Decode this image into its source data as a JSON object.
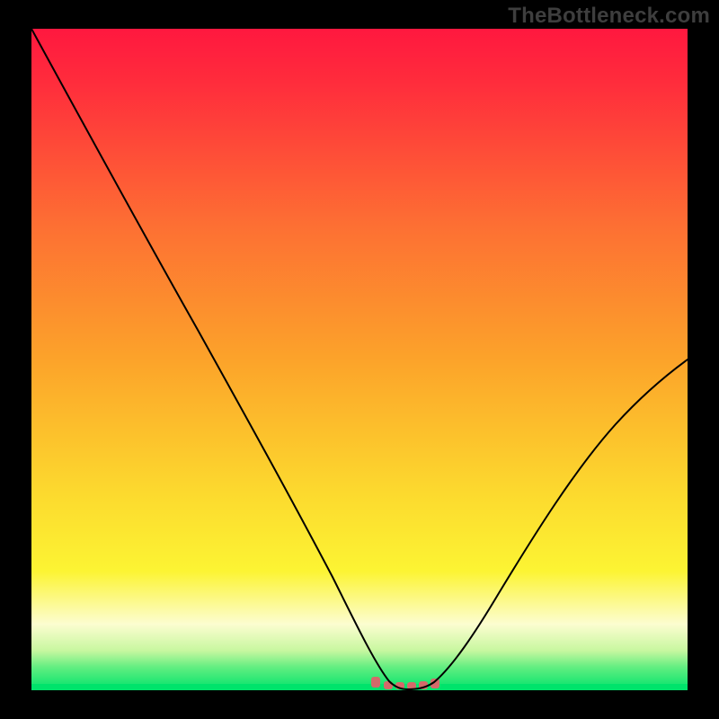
{
  "watermark": "TheBottleneck.com",
  "chart_data": {
    "type": "line",
    "title": "",
    "xlabel": "",
    "ylabel": "",
    "xlim": [
      0,
      100
    ],
    "ylim": [
      0,
      100
    ],
    "x": [
      0,
      5,
      10,
      15,
      20,
      25,
      30,
      35,
      40,
      45,
      50,
      52,
      54,
      56,
      58,
      60,
      62,
      65,
      70,
      75,
      80,
      85,
      90,
      95,
      100
    ],
    "values": [
      100,
      92,
      84,
      76,
      68,
      60,
      51,
      42,
      32,
      22,
      12,
      6,
      2,
      0,
      0,
      0,
      1,
      4,
      11,
      20,
      30,
      38,
      44,
      48,
      50
    ],
    "curve_color": "#000000",
    "baseline_color": "#00E36B",
    "marker_color": "#D46A6A",
    "marker_x_range": [
      52,
      62
    ],
    "background_gradient": {
      "top": "#FF183F",
      "mid_orange": "#FCA32A",
      "mid_yellow": "#FCF433",
      "pale": "#FCFDD0",
      "bottom": "#00E36B"
    }
  }
}
